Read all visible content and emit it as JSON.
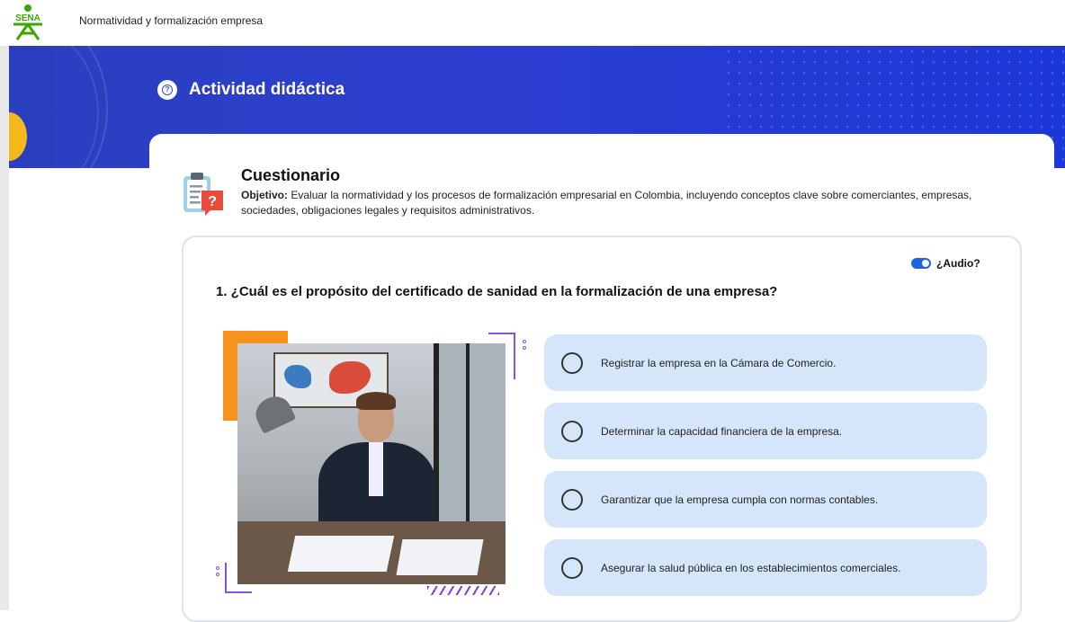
{
  "topbar": {
    "logo_text": "SENA",
    "title": "Normatividad y formalización empresa"
  },
  "banner": {
    "section_icon": "question-circle-icon",
    "section_title": "Actividad didáctica"
  },
  "quiz": {
    "title": "Cuestionario",
    "objective_label": "Objetivo:",
    "objective_text": " Evaluar la normatividad y los procesos de formalización empresarial en Colombia, incluyendo conceptos clave sobre comerciantes, empresas, sociedades, obligaciones legales y requisitos administrativos.",
    "icon": "clipboard-question-icon"
  },
  "audio": {
    "label": "¿Audio?",
    "enabled": true
  },
  "question": {
    "text": "1. ¿Cuál es el propósito del certificado de sanidad en la formalización de una empresa?",
    "image": "businessman-with-calculator-photo",
    "options": [
      {
        "label": "Registrar la empresa en la Cámara de Comercio."
      },
      {
        "label": "Determinar la capacidad financiera de la empresa."
      },
      {
        "label": "Garantizar que la empresa cumpla con normas contables."
      },
      {
        "label": "Asegurar la salud pública en los establecimientos comerciales."
      }
    ]
  },
  "colors": {
    "banner": "#2d3fd0",
    "option_bg": "#d6e6fa",
    "accent_purple": "#8a4fe0",
    "accent_orange": "#f7941d",
    "toggle": "#1f63e0"
  }
}
